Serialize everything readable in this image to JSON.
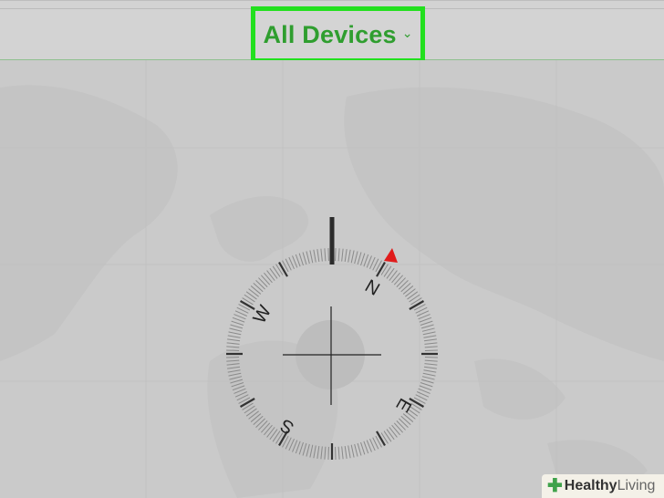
{
  "header": {
    "device_selector": {
      "label": "All Devices",
      "chevron_icon": "chevron-down-icon",
      "highlight_color": "#22e01e",
      "text_color": "#2f9e2f"
    }
  },
  "compass": {
    "labels": {
      "north": "N",
      "east": "E",
      "south": "S",
      "west": "W"
    },
    "heading_marker_color": "#e01b1b"
  },
  "watermark": {
    "brand_bold": "Healthy",
    "brand_light": "Living"
  }
}
